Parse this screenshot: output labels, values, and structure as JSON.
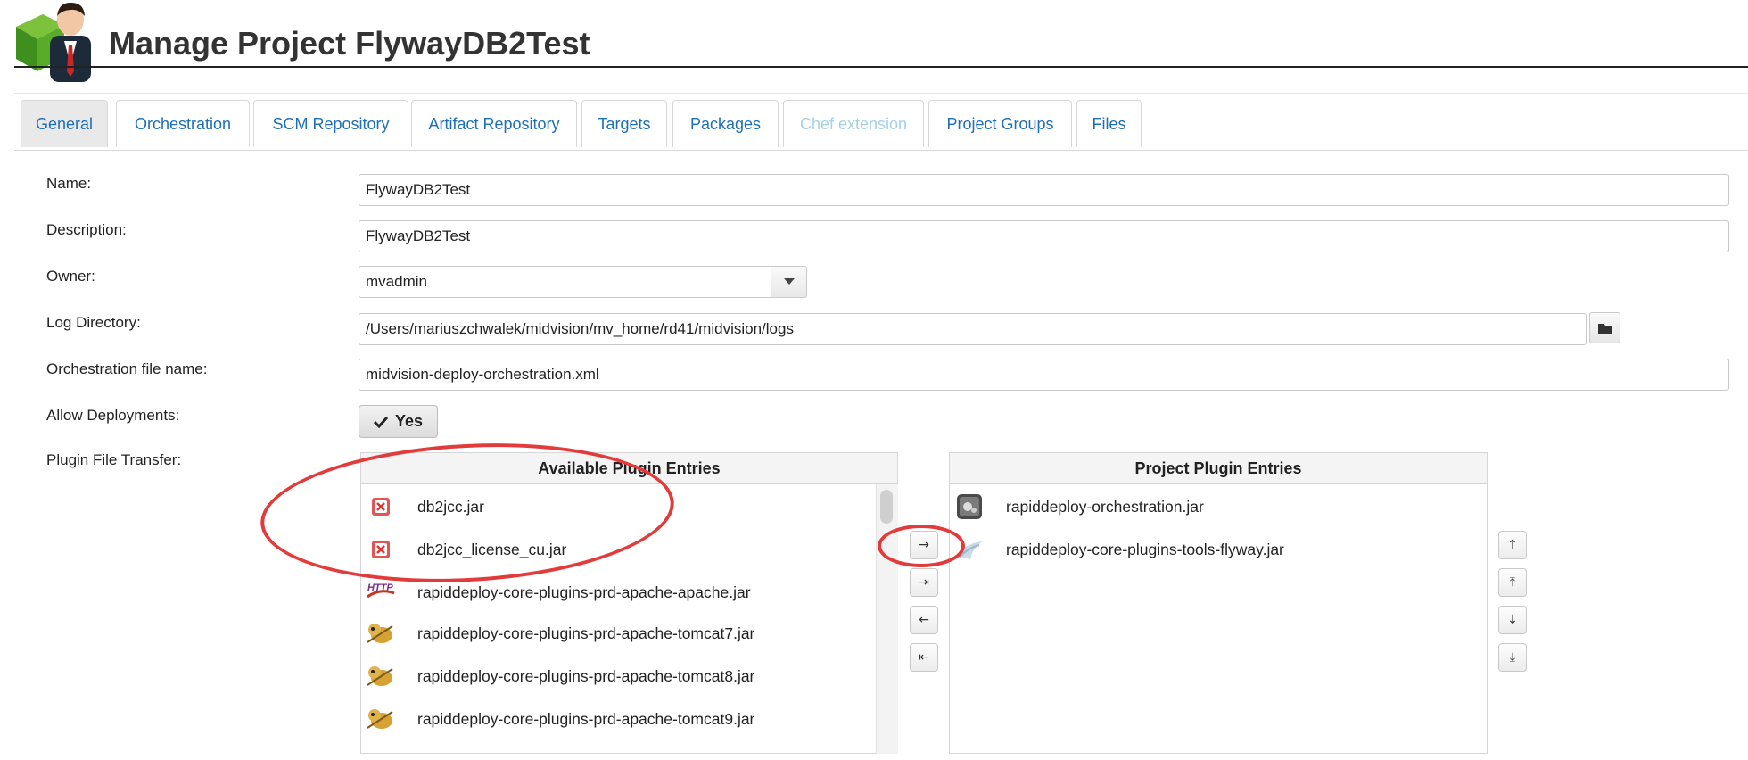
{
  "header": {
    "title": "Manage Project FlywayDB2Test"
  },
  "tabs": [
    {
      "label": "General",
      "state": "active"
    },
    {
      "label": "Orchestration",
      "state": "normal"
    },
    {
      "label": "SCM Repository",
      "state": "normal"
    },
    {
      "label": "Artifact Repository",
      "state": "normal"
    },
    {
      "label": "Targets",
      "state": "normal"
    },
    {
      "label": "Packages",
      "state": "normal"
    },
    {
      "label": "Chef extension",
      "state": "disabled"
    },
    {
      "label": "Project Groups",
      "state": "normal"
    },
    {
      "label": "Files",
      "state": "normal"
    }
  ],
  "form": {
    "name_label": "Name:",
    "name_value": "FlywayDB2Test",
    "description_label": "Description:",
    "description_value": "FlywayDB2Test",
    "owner_label": "Owner:",
    "owner_value": "mvadmin",
    "logdir_label": "Log Directory:",
    "logdir_value": "/Users/mariuszchwalek/midvision/mv_home/rd41/midvision/logs",
    "orchfile_label": "Orchestration file name:",
    "orchfile_value": "midvision-deploy-orchestration.xml",
    "allow_label": "Allow Deployments:",
    "allow_value": "Yes",
    "plugin_label": "Plugin File Transfer:"
  },
  "available": {
    "title": "Available Plugin Entries",
    "items": [
      {
        "label": "db2jcc.jar",
        "icon": "missing-plugin-icon"
      },
      {
        "label": "db2jcc_license_cu.jar",
        "icon": "missing-plugin-icon"
      },
      {
        "label": "rapiddeploy-core-plugins-prd-apache-apache.jar",
        "icon": "apache-http-icon"
      },
      {
        "label": "rapiddeploy-core-plugins-prd-apache-tomcat7.jar",
        "icon": "tomcat-icon"
      },
      {
        "label": "rapiddeploy-core-plugins-prd-apache-tomcat8.jar",
        "icon": "tomcat-icon"
      },
      {
        "label": "rapiddeploy-core-plugins-prd-apache-tomcat9.jar",
        "icon": "tomcat-icon"
      }
    ]
  },
  "project": {
    "title": "Project Plugin Entries",
    "items": [
      {
        "label": "rapiddeploy-orchestration.jar",
        "icon": "orchestration-icon"
      },
      {
        "label": "rapiddeploy-core-plugins-tools-flyway.jar",
        "icon": "flyway-icon"
      }
    ]
  },
  "transfer_buttons": [
    "→",
    "⇥",
    "←",
    "⇤"
  ],
  "order_buttons": [
    "↑",
    "⤒",
    "↓",
    "⤓"
  ],
  "colors": {
    "link": "#1e6fb4",
    "disabled_tab": "#a6cfe8",
    "annotation": "#e23b3b"
  }
}
